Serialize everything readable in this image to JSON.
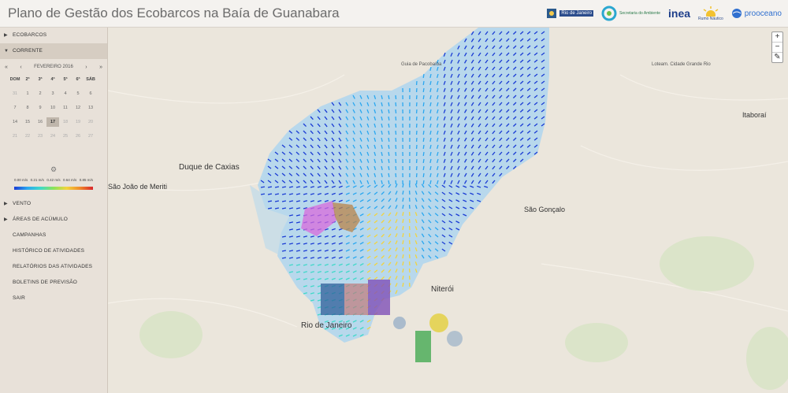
{
  "header": {
    "title": "Plano de Gestão dos Ecobarcos na Baía de Guanabara"
  },
  "logos": [
    {
      "name": "Rio de Janeiro",
      "icon": "state-logo"
    },
    {
      "name": "Secretaria do Ambiente",
      "icon": "swirl-logo"
    },
    {
      "name": "inea",
      "icon": "inea-logo"
    },
    {
      "name": "Rumo Náutico",
      "icon": "sun-logo"
    },
    {
      "name": "prooceano",
      "icon": "globe-logo"
    }
  ],
  "sidebar": {
    "ecobarcos": "ECOBARCOS",
    "corrente": "CORRENTE",
    "calendar": {
      "month": "FEVEREIRO 2016",
      "prev": "«",
      "prev_month": "‹",
      "next_month": "›",
      "next": "»",
      "weekdays": [
        "DOM",
        "2ª",
        "3ª",
        "4ª",
        "5ª",
        "6ª",
        "SÁB"
      ],
      "days": [
        "31",
        "1",
        "2",
        "3",
        "4",
        "5",
        "6",
        "7",
        "8",
        "9",
        "10",
        "11",
        "12",
        "13",
        "14",
        "15",
        "16",
        "17",
        "18",
        "19",
        "20",
        "21",
        "22",
        "23",
        "24",
        "25",
        "26",
        "27"
      ]
    },
    "legend": {
      "ticks": [
        "0.00\nm/s",
        "0.21\nm/s",
        "0.42\nm/s",
        "0.64\nm/s",
        "0.85\nm/s"
      ]
    },
    "items": [
      "VENTO",
      "ÁREAS DE ACÚMULO",
      "CAMPANHAS",
      "HISTÓRICO DE ATIVIDADES",
      "RELATÓRIOS DAS ATIVIDADES",
      "BOLETINS DE PREVISÃO",
      "SAIR"
    ]
  },
  "map": {
    "labels": [
      {
        "text": "Duque de Caxias",
        "cls": "big"
      },
      {
        "text": "São João de Meriti",
        "cls": ""
      },
      {
        "text": "São Gonçalo",
        "cls": ""
      },
      {
        "text": "Niterói",
        "cls": "big"
      },
      {
        "text": "Rio de Janeiro",
        "cls": "big"
      },
      {
        "text": "Itaboraí",
        "cls": ""
      },
      {
        "text": "Guia de Pacobaíba",
        "cls": "sm"
      },
      {
        "text": "Loteam. Cidade Grande Rio",
        "cls": "sm"
      }
    ],
    "zoom_in": "+",
    "zoom_out": "−",
    "edit": "✎"
  },
  "colors": {
    "header_bg": "#f4f2ef",
    "sidebar_bg": "#e8e1d9",
    "water": "#b8d8ec",
    "land": "#ebe6dc"
  }
}
